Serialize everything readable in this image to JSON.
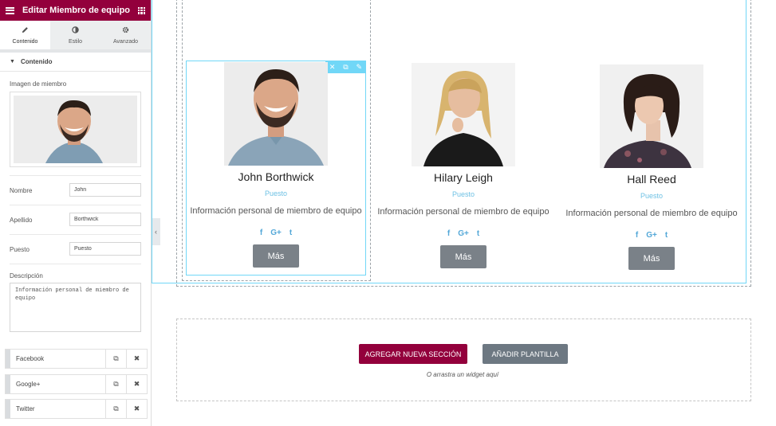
{
  "panel": {
    "title": "Editar Miembro de equipo",
    "tabs": [
      {
        "label": "Contenido",
        "icon": "pencil-icon",
        "active": true
      },
      {
        "label": "Estilo",
        "icon": "contrast-icon",
        "active": false
      },
      {
        "label": "Avanzado",
        "icon": "gear-icon",
        "active": false
      }
    ],
    "section_title": "Contenido",
    "image_label": "Imagen de miembro",
    "fields": {
      "nombre": {
        "label": "Nombre",
        "value": "John"
      },
      "apellido": {
        "label": "Apellido",
        "value": "Borthwick"
      },
      "puesto": {
        "label": "Puesto",
        "value": "Puesto"
      }
    },
    "description": {
      "label": "Descripción",
      "value": "Información personal de miembro de equipo"
    },
    "social_items": [
      "Facebook",
      "Google+",
      "Twitter"
    ],
    "accent_color": "#93003c"
  },
  "members": [
    {
      "name": "John Borthwick",
      "role": "Puesto",
      "info": "Información personal de miembro de equipo",
      "button": "Más"
    },
    {
      "name": "Hilary Leigh",
      "role": "Puesto",
      "info": "Información personal de miembro de equipo",
      "button": "Más"
    },
    {
      "name": "Hall Reed",
      "role": "Puesto",
      "info": "Información personal de miembro de equipo",
      "button": "Más"
    }
  ],
  "social_icons": [
    "f",
    "G+",
    "t"
  ],
  "add_section": {
    "add_button": "AGREGAR NUEVA SECCIÓN",
    "template_button": "AÑADIR PLANTILLA",
    "hint": "O arrastra un widget aquí"
  },
  "colors": {
    "brand": "#93003c",
    "selection": "#71d7f7",
    "role_text": "#6ec1e4",
    "social": "#54a8d8",
    "button": "#7a8188"
  }
}
